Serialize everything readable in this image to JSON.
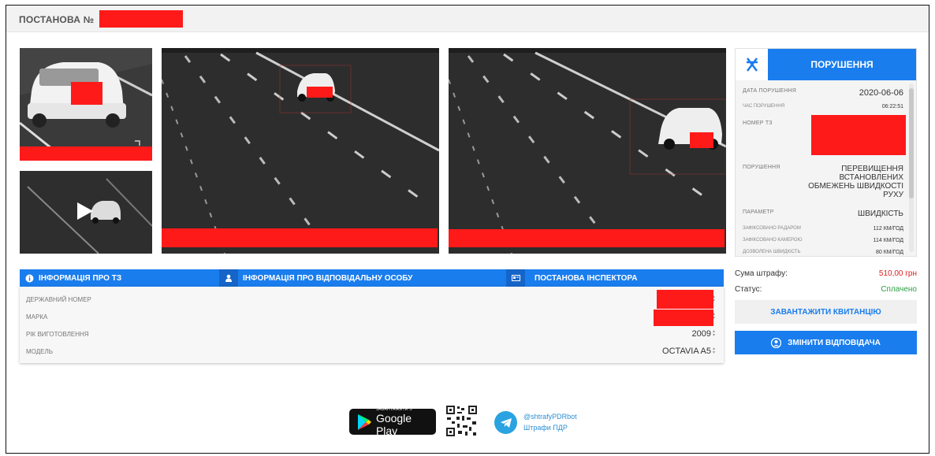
{
  "header": {
    "title": "ПОСТАНОВА №"
  },
  "media": {
    "play_icon": "play-icon",
    "expand_icon": "expand-icon"
  },
  "violation_panel": {
    "title": "ПОРУШЕННЯ",
    "rows": {
      "date_label": "ДАТА ПОРУШЕННЯ",
      "date_value": "2020-06-06",
      "time_label": "ЧАС ПОРУШЕННЯ",
      "time_value": "06:22:51",
      "plate_label": "НОМЕР ТЗ",
      "violation_label": "ПОРУШЕННЯ",
      "violation_value": "ПЕРЕВИЩЕННЯ ВСТАНОВЛЕНИХ ОБМЕЖЕНЬ ШВИДКОСТІ РУХУ",
      "param_label": "ПАРАМЕТР",
      "param_value": "ШВИДКІСТЬ",
      "radar_label": "ЗАФІКСОВАНО РАДАРОМ",
      "radar_value": "112 КМ/ГОД",
      "camera_label": "ЗАФІКСОВАНО КАМЕРОЮ",
      "camera_value": "114 КМ/ГОД",
      "limit_label": "ДОЗВОЛЕНА ШВИДКІСТЬ",
      "limit_value": "80 КМ/ГОД"
    }
  },
  "tabs": [
    {
      "label": "ІНФОРМАЦІЯ ПРО ТЗ",
      "icon": "info-icon"
    },
    {
      "label": "ІНФОРМАЦІЯ ПРО ВІДПОВІДАЛЬНУ ОСОБУ",
      "icon": "person-icon"
    },
    {
      "label": "ПОСТАНОВА ІНСПЕКТОРА",
      "icon": "id-card-icon"
    }
  ],
  "vehicle": {
    "plate_label": "ДЕРЖАВНИЙ НОМЕР",
    "brand_label": "МАРКА",
    "year_label": "РІК ВИГОТОВЛЕННЯ",
    "year_value": "2009",
    "model_label": "МОДЕЛЬ",
    "model_value": "OCTAVIA A5"
  },
  "fine": {
    "sum_label": "Сума штрафу:",
    "sum_value": "510,00 грн",
    "status_label": "Статус:",
    "status_value": "Сплачено",
    "download_button": "ЗАВАНТАЖИТИ КВИТАНЦІЮ",
    "change_button": "ЗМІНИТИ ВІДПОВІДАЧА"
  },
  "footer": {
    "gp_small": "ЗАВАНТАЖИТИ З",
    "gp_big": "Google Play",
    "tg_handle": "@shtrafyPDRbot",
    "tg_name": "Штрафи ПДР"
  },
  "colors": {
    "accent": "#1a7ded",
    "redaction": "#ff1a1a",
    "fine": "#e02020",
    "paid": "#2ea043"
  }
}
